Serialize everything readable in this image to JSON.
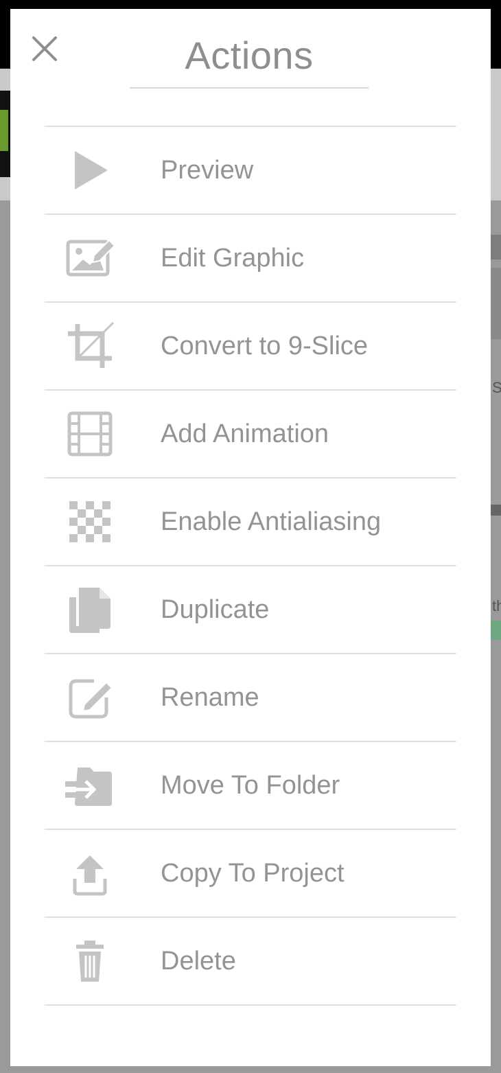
{
  "dialog": {
    "title": "Actions",
    "close_icon": "close-icon"
  },
  "background": {
    "peek_text_1": "S",
    "peek_text_2": "th"
  },
  "actions": [
    {
      "label": "Preview",
      "icon": "play-icon"
    },
    {
      "label": "Edit Graphic",
      "icon": "image-edit-icon"
    },
    {
      "label": "Convert to 9-Slice",
      "icon": "crop-icon"
    },
    {
      "label": "Add Animation",
      "icon": "film-icon"
    },
    {
      "label": "Enable Antialiasing",
      "icon": "checkerboard-icon"
    },
    {
      "label": "Duplicate",
      "icon": "copy-icon"
    },
    {
      "label": "Rename",
      "icon": "pencil-square-icon"
    },
    {
      "label": "Move To Folder",
      "icon": "folder-move-icon"
    },
    {
      "label": "Copy To Project",
      "icon": "upload-icon"
    },
    {
      "label": "Delete",
      "icon": "trash-icon"
    }
  ],
  "colors": {
    "icon": "#c4c4c4",
    "text": "#939393",
    "divider": "#dedede",
    "overlay": "#9a9a9a"
  }
}
